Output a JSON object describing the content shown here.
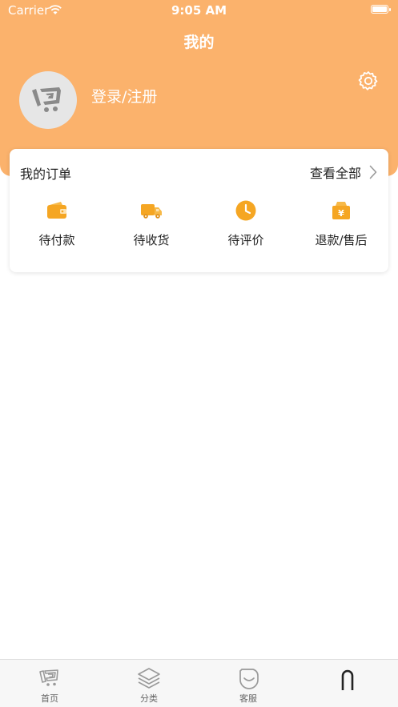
{
  "status_bar": {
    "carrier": "Carrier",
    "time": "9:05 AM"
  },
  "page": {
    "title": "我的"
  },
  "profile": {
    "login_label": "登录/注册"
  },
  "orders": {
    "title": "我的订单",
    "view_all": "查看全部",
    "items": [
      {
        "label": "待付款",
        "icon": "wallet-icon"
      },
      {
        "label": "待收货",
        "icon": "truck-icon"
      },
      {
        "label": "待评价",
        "icon": "clock-icon"
      },
      {
        "label": "退款/售后",
        "icon": "refund-icon"
      }
    ]
  },
  "tabbar": {
    "tabs": [
      {
        "label": "首页",
        "icon": "home-logo-icon"
      },
      {
        "label": "分类",
        "icon": "layers-icon"
      },
      {
        "label": "客服",
        "icon": "chat-icon"
      },
      {
        "label": "",
        "icon": "profile-icon"
      }
    ]
  },
  "colors": {
    "accent": "#fbb26c",
    "icon_orange": "#f5a623",
    "text": "#222222"
  }
}
